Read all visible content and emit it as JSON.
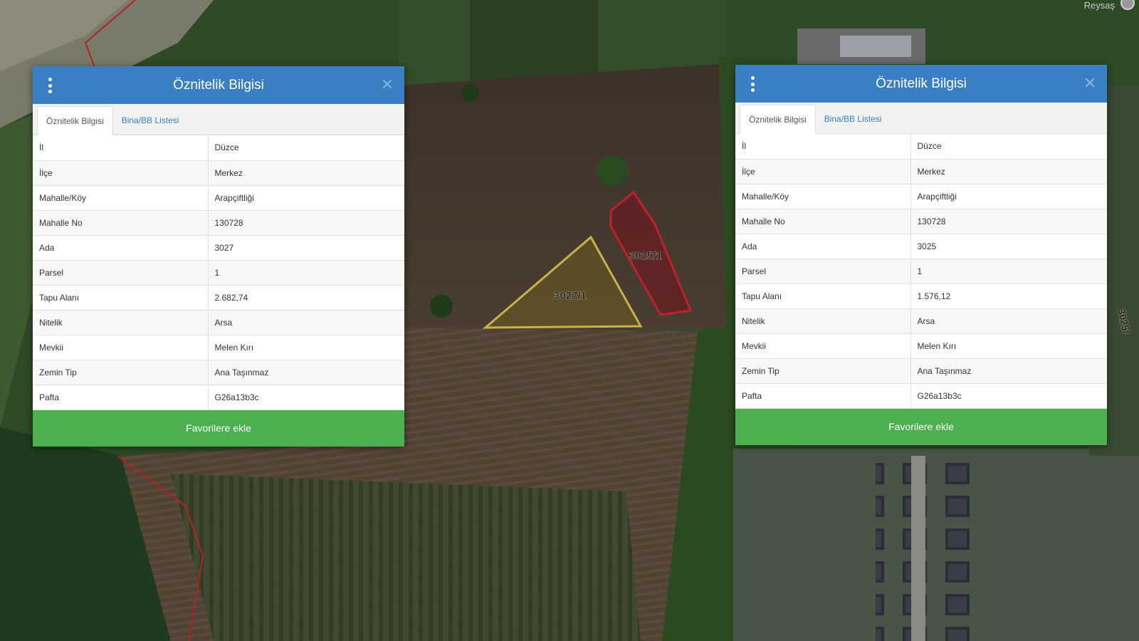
{
  "map": {
    "parcels": [
      {
        "label": "3027/1",
        "color": "#c8b24a"
      },
      {
        "label": "3025/1",
        "color": "#c0202a"
      }
    ],
    "corner_text": "Reysaş",
    "edge_label": "3025/",
    "colors": {
      "field_dark": "#3c3127",
      "field_light": "#5a4a3c",
      "grass": "#2f4a26",
      "forest": "#1f3a1e",
      "boundary": "#b22222"
    }
  },
  "panels": [
    {
      "title": "Öznitelik Bilgisi",
      "tabs": [
        "Öznitelik Bilgisi",
        "Bina/BB Listesi"
      ],
      "rows": [
        {
          "key": "İl",
          "value": "Düzce"
        },
        {
          "key": "İlçe",
          "value": "Merkez"
        },
        {
          "key": "Mahalle/Köy",
          "value": "Arapçiftliği"
        },
        {
          "key": "Mahalle No",
          "value": "130728"
        },
        {
          "key": "Ada",
          "value": "3027"
        },
        {
          "key": "Parsel",
          "value": "1"
        },
        {
          "key": "Tapu Alanı",
          "value": "2.682,74"
        },
        {
          "key": "Nitelik",
          "value": "Arsa"
        },
        {
          "key": "Mevkii",
          "value": "Melen Kırı"
        },
        {
          "key": "Zemin Tip",
          "value": "Ana Taşınmaz"
        },
        {
          "key": "Pafta",
          "value": "G26a13b3c"
        }
      ],
      "button": "Favorilere ekle"
    },
    {
      "title": "Öznitelik Bilgisi",
      "tabs": [
        "Öznitelik Bilgisi",
        "Bina/BB Listesi"
      ],
      "rows": [
        {
          "key": "İl",
          "value": "Düzce"
        },
        {
          "key": "İlçe",
          "value": "Merkez"
        },
        {
          "key": "Mahalle/Köy",
          "value": "Arapçiftliği"
        },
        {
          "key": "Mahalle No",
          "value": "130728"
        },
        {
          "key": "Ada",
          "value": "3025"
        },
        {
          "key": "Parsel",
          "value": "1"
        },
        {
          "key": "Tapu Alanı",
          "value": "1.576,12"
        },
        {
          "key": "Nitelik",
          "value": "Arsa"
        },
        {
          "key": "Mevkii",
          "value": "Melen Kırı"
        },
        {
          "key": "Zemin Tip",
          "value": "Ana Taşınmaz"
        },
        {
          "key": "Pafta",
          "value": "G26a13b3c"
        }
      ],
      "button": "Favorilere ekle"
    }
  ]
}
